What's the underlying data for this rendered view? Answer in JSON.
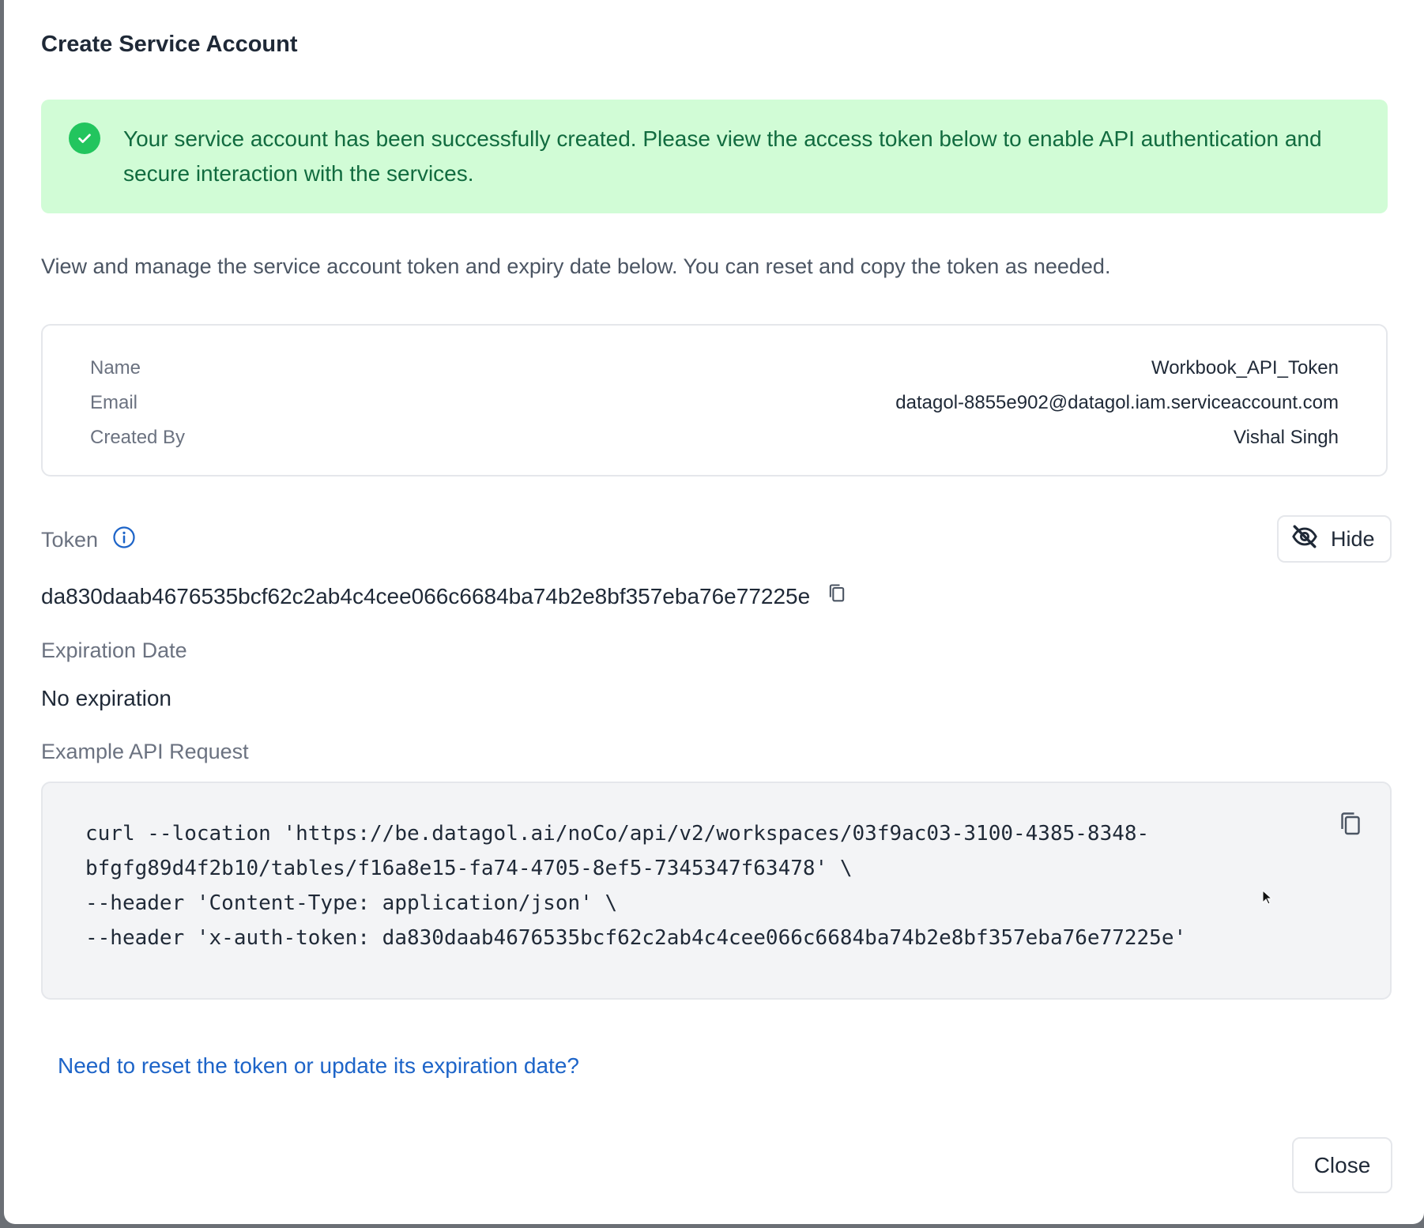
{
  "dialog": {
    "title": "Create Service Account",
    "success_message": "Your service account has been successfully created. Please view the access token below to enable API authentication and secure interaction with the services.",
    "description": "View and manage the service account token and expiry date below. You can reset and copy the token as needed."
  },
  "account_info": [
    {
      "label": "Name",
      "value": "Workbook_API_Token"
    },
    {
      "label": "Email",
      "value": "datagol-8855e902@datagol.iam.serviceaccount.com"
    },
    {
      "label": "Created By",
      "value": "Vishal Singh"
    }
  ],
  "token": {
    "label": "Token",
    "value": "da830daab4676535bcf62c2ab4c4cee066c6684ba74b2e8bf357eba76e77225e",
    "hide_label": "Hide"
  },
  "expiration": {
    "label": "Expiration Date",
    "value": "No expiration"
  },
  "example": {
    "label": "Example API Request",
    "code": "curl --location 'https://be.datagol.ai/noCo/api/v2/workspaces/03f9ac03-3100-4385-8348-\nbfgfg89d4f2b10/tables/f16a8e15-fa74-4705-8ef5-7345347f63478' \\\n--header 'Content-Type: application/json' \\\n--header 'x-auth-token: da830daab4676535bcf62c2ab4c4cee066c6684ba74b2e8bf357eba76e77225e'"
  },
  "reset_link": "Need to reset the token or update its expiration date?",
  "close_label": "Close",
  "colors": {
    "success_bg": "#d1fcd6",
    "success_text": "#116b3f",
    "success_icon": "#22c55e",
    "link": "#1d64c8",
    "info_icon": "#1d64c8"
  },
  "icons": [
    "check-circle-icon",
    "info-icon",
    "eye-off-icon",
    "copy-icon",
    "mouse-cursor-icon"
  ]
}
